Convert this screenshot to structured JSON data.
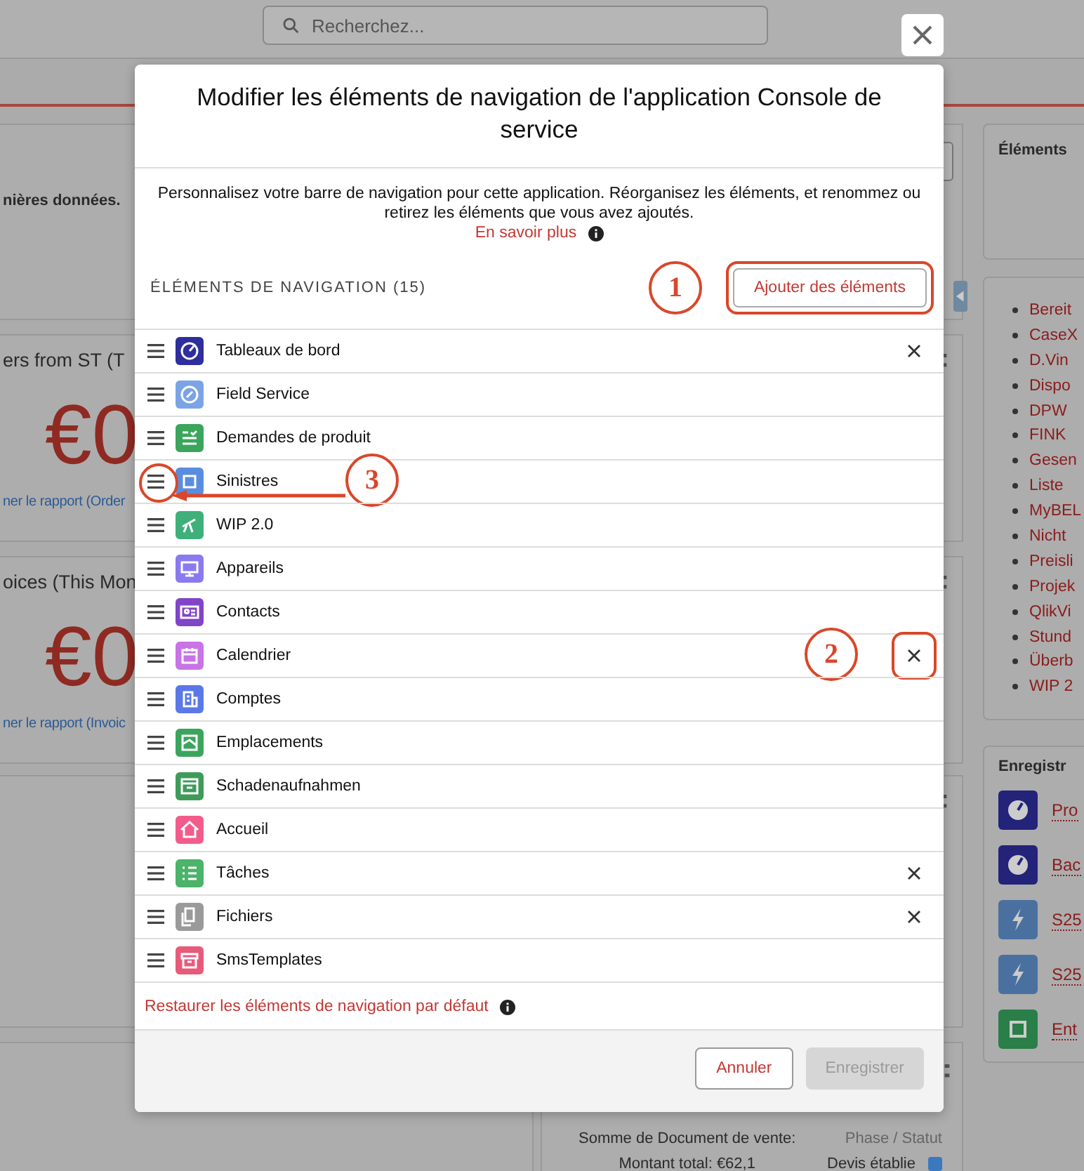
{
  "header": {
    "search": {
      "placeholder": "Recherchez..."
    }
  },
  "background": {
    "notice": "nières données.",
    "report_cards": [
      {
        "title": "ers from ST (T",
        "amount": "€0",
        "link": "ner le rapport (Order"
      },
      {
        "title": "oices (This Mon",
        "amount": "€0",
        "link": "ner le rapport (Invoic"
      }
    ],
    "summary": {
      "label": "Somme de Document de vente:",
      "total": "Montant total: €62,1",
      "legend_title": "Phase / Statut",
      "legend": [
        {
          "label": "Devis établie",
          "color": "#3a78c0"
        }
      ]
    },
    "right_panel": {
      "title": "Éléments",
      "links": [
        "Bereit",
        "CaseX",
        "D.Vin",
        "Dispo",
        "DPW",
        "FINK",
        "Gesen",
        "Liste",
        "MyBEL",
        "Nicht",
        "Preisli",
        "Projek",
        "QlikVi",
        "Stund",
        "Überb",
        "WIP 2"
      ],
      "records_title": "Enregistr",
      "records": [
        {
          "label": "Pro",
          "kind": "dashboard",
          "color": "#23237a"
        },
        {
          "label": "Bac",
          "kind": "dashboard",
          "color": "#23237a"
        },
        {
          "label": "S25",
          "kind": "event",
          "color": "#4a70a0"
        },
        {
          "label": "S25",
          "kind": "event",
          "color": "#4a70a0"
        },
        {
          "label": "Ent",
          "kind": "location",
          "color": "#2a7e48"
        }
      ]
    }
  },
  "modal": {
    "title": "Modifier les éléments de navigation de l'application Console de service",
    "description": "Personnalisez votre barre de navigation pour cette application. Réorganisez les éléments, et renommez ou retirez les éléments que vous avez ajoutés.",
    "learn_more": "En savoir plus",
    "section_label": "ÉLÉMENTS DE NAVIGATION (15)",
    "add_button": {
      "label": "Ajouter des éléments",
      "callout": "1"
    },
    "items": [
      {
        "name": "Tableaux de bord",
        "kind": "dashboard",
        "color": "#2e2e9e",
        "removable": true
      },
      {
        "name": "Field Service",
        "kind": "service",
        "color": "#7ba4e6",
        "removable": false
      },
      {
        "name": "Demandes de produit",
        "kind": "request",
        "color": "#3ba55c",
        "removable": false
      },
      {
        "name": "Sinistres",
        "kind": "claim",
        "color": "#5a8de0",
        "removable": false,
        "callout": {
          "number": "3",
          "kind": "handle"
        }
      },
      {
        "name": "WIP 2.0",
        "kind": "tool",
        "color": "#3fb07a",
        "removable": false
      },
      {
        "name": "Appareils",
        "kind": "device",
        "color": "#8a7af0",
        "removable": false
      },
      {
        "name": "Contacts",
        "kind": "contact",
        "color": "#8045c8",
        "removable": false
      },
      {
        "name": "Calendrier",
        "kind": "calendar",
        "color": "#c873e6",
        "removable": true,
        "callout": {
          "number": "2",
          "kind": "remove"
        }
      },
      {
        "name": "Comptes",
        "kind": "account",
        "color": "#5a78e8",
        "removable": false
      },
      {
        "name": "Emplacements",
        "kind": "location",
        "color": "#3ba55c",
        "removable": false
      },
      {
        "name": "Schadenaufnahmen",
        "kind": "form",
        "color": "#3f9b5a",
        "removable": false
      },
      {
        "name": "Accueil",
        "kind": "home",
        "color": "#f25c8c",
        "removable": false
      },
      {
        "name": "Tâches",
        "kind": "task",
        "color": "#4bb36a",
        "removable": true
      },
      {
        "name": "Fichiers",
        "kind": "file",
        "color": "#9a9a9a",
        "removable": true
      },
      {
        "name": "SmsTemplates",
        "kind": "template",
        "color": "#e85a7a",
        "removable": false
      }
    ],
    "restore_link": "Restaurer les éléments de navigation par défaut",
    "cancel": "Annuler",
    "save": {
      "label": "Enregistrer",
      "disabled": true
    }
  }
}
